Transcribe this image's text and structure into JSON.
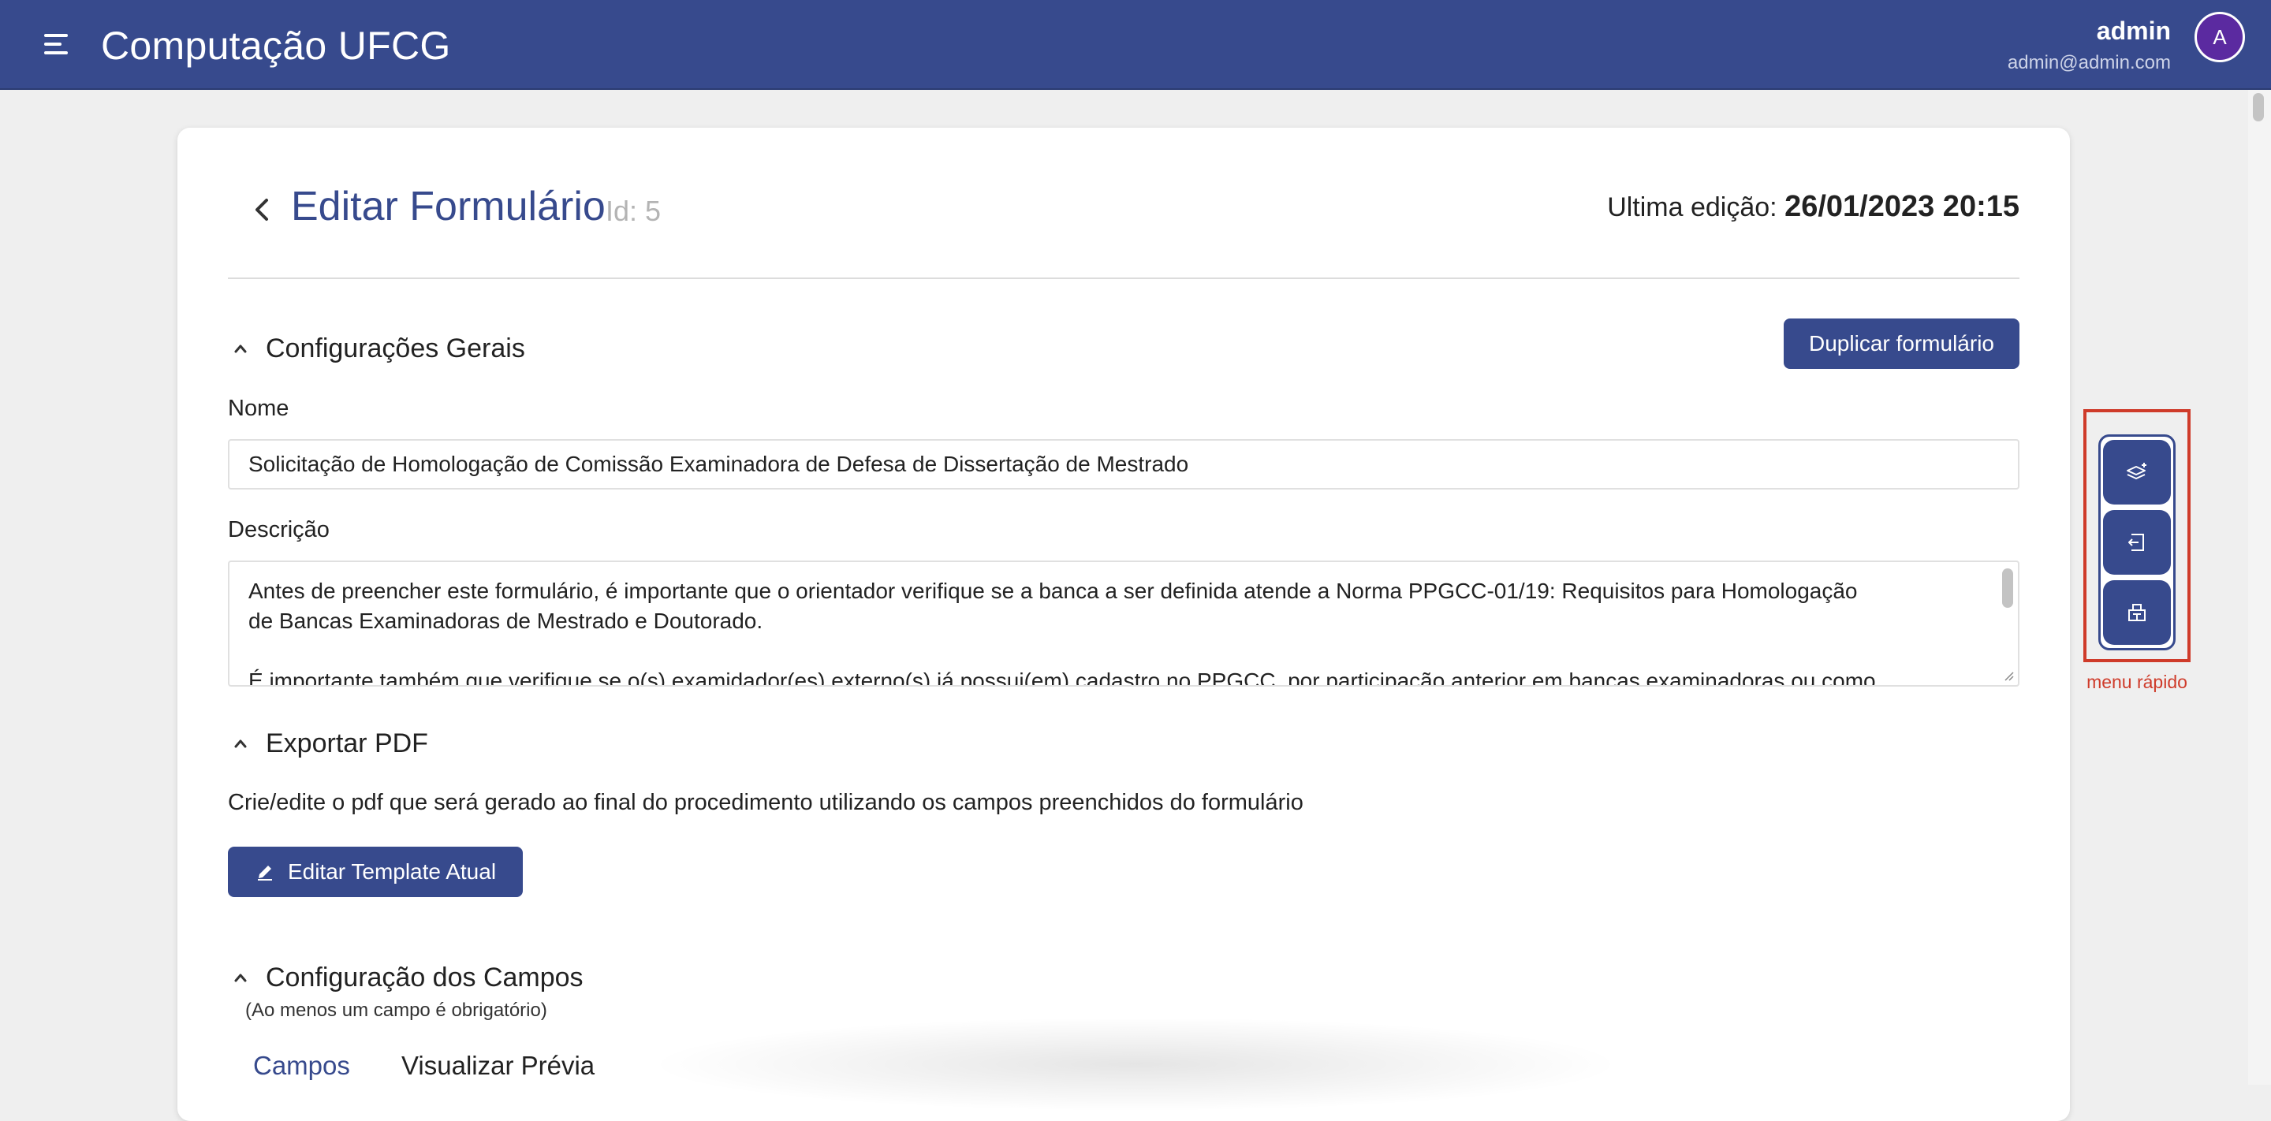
{
  "header": {
    "app_title": "Computação UFCG",
    "user_name": "admin",
    "user_email": "admin@admin.com",
    "avatar_initial": "A",
    "menu_icon": "hamburger-menu-icon"
  },
  "page": {
    "title": "Editar Formulário",
    "id_text": "Id: 5",
    "last_edit_label": "Ultima edição:",
    "last_edit_value": "26/01/2023 20:15"
  },
  "general": {
    "section_title": "Configurações Gerais",
    "duplicate_label": "Duplicar formulário",
    "name_label": "Nome",
    "name_value": "Solicitação de Homologação de Comissão Examinadora de Defesa de Dissertação de Mestrado",
    "description_label": "Descrição",
    "description_line1": "Antes de preencher este formulário, é importante que o orientador verifique se a banca a ser definida atende a Norma PPGCC-01/19: Requisitos para Homologação",
    "description_line2": "de Bancas Examinadoras de Mestrado e Doutorado.",
    "description_line3": "É importante também que verifique se o(s) examidador(es) externo(s) já possui(em) cadastro no PPGCC, por participação anterior em bancas examinadoras ou como"
  },
  "export": {
    "section_title": "Exportar PDF",
    "description": "Crie/edite o pdf que será gerado ao final do procedimento utilizando os campos preenchidos do formulário",
    "edit_template_label": "Editar Template Atual"
  },
  "fields": {
    "section_title": "Configuração dos Campos",
    "note": "(Ao menos um campo é obrigatório)",
    "tabs": [
      {
        "label": "Campos",
        "active": true
      },
      {
        "label": "Visualizar Prévia",
        "active": false
      }
    ]
  },
  "quick_menu": {
    "label": "menu rápido",
    "buttons": [
      {
        "icon": "layers-plus-icon"
      },
      {
        "icon": "exit-arrow-icon"
      },
      {
        "icon": "building-icon"
      }
    ]
  },
  "colors": {
    "primary": "#374a8d",
    "highlight": "#cf3b2a",
    "avatar": "#5b2aa0",
    "background": "#efefef"
  }
}
